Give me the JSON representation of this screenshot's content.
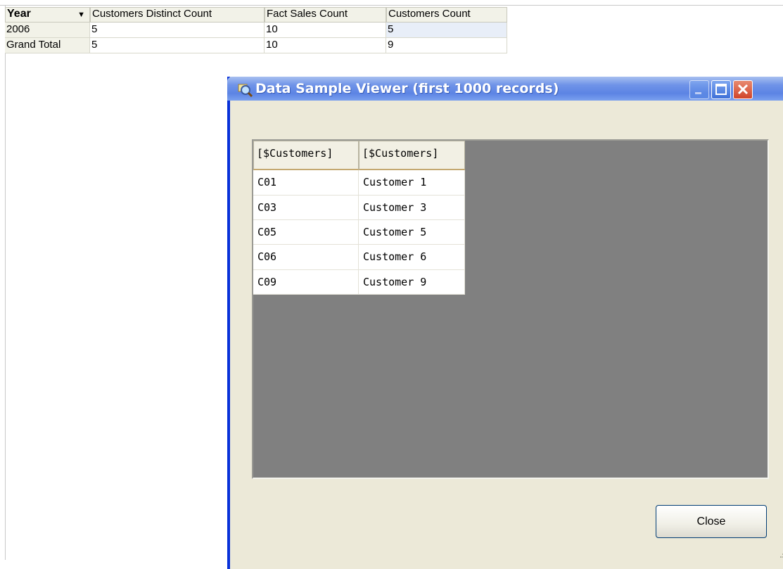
{
  "pivot": {
    "headers": [
      "Year",
      "Customers Distinct Count",
      "Fact Sales Count",
      "Customers Count"
    ],
    "rows": [
      {
        "label": "2006",
        "values": [
          "5",
          "10",
          "5"
        ]
      },
      {
        "label": "Grand Total",
        "values": [
          "5",
          "10",
          "9"
        ]
      }
    ],
    "icons": {
      "year_filter": "dropdown-arrow-icon"
    }
  },
  "dialog": {
    "title": "Data Sample Viewer (first 1000 records)",
    "icons": {
      "title": "magnifier-icon",
      "minimize": "minimize-icon",
      "maximize": "maximize-icon",
      "close": "close-icon"
    },
    "grid": {
      "columns": [
        "[$Customers]",
        "[$Customers]"
      ],
      "rows": [
        [
          "C01",
          "Customer 1"
        ],
        [
          "C03",
          "Customer 3"
        ],
        [
          "C05",
          "Customer 5"
        ],
        [
          "C06",
          "Customer 6"
        ],
        [
          "C09",
          "Customer 9"
        ]
      ]
    },
    "close_label": "Close",
    "colors": {
      "title_bar": "#5c84e4",
      "frame": "#0831d9",
      "body": "#ece9d8",
      "grid_bg": "#808080",
      "close_btn": "#d0442a"
    }
  }
}
